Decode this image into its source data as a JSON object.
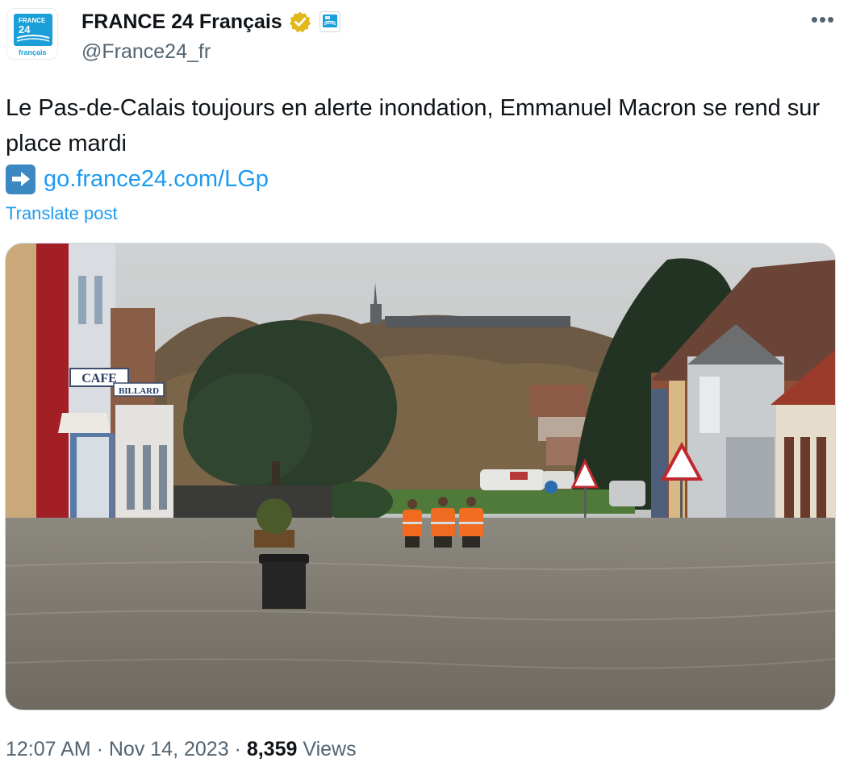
{
  "account": {
    "display_name": "FRANCE 24 Français",
    "handle": "@France24_fr",
    "avatar_logo": {
      "line1": "FRANCE",
      "line2": "24",
      "line3": "français"
    },
    "verified_icon": "gold-verified-badge-icon",
    "affiliate_icon": "france24-affiliate-icon"
  },
  "menu": {
    "more_label": "•••"
  },
  "post": {
    "text": "Le Pas-de-Calais toujours en alerte inondation, Emmanuel Macron se rend sur place mardi",
    "link_icon": "right-arrow-emoji-icon",
    "link_text": "go.france24.com/LGp",
    "translate_label": "Translate post"
  },
  "photo": {
    "shop_signs": {
      "cafe": "CAFE",
      "billard": "BILLARD"
    }
  },
  "footer": {
    "time": "12:07 AM",
    "separator": "·",
    "date": "Nov 14, 2023",
    "views_count": "8,359",
    "views_label": "Views"
  },
  "colors": {
    "link": "#1d9bf0",
    "secondary_text": "#536471",
    "primary_text": "#0f1419",
    "verified_gold": "#e2b719",
    "brand_blue": "#1a9fd8"
  }
}
